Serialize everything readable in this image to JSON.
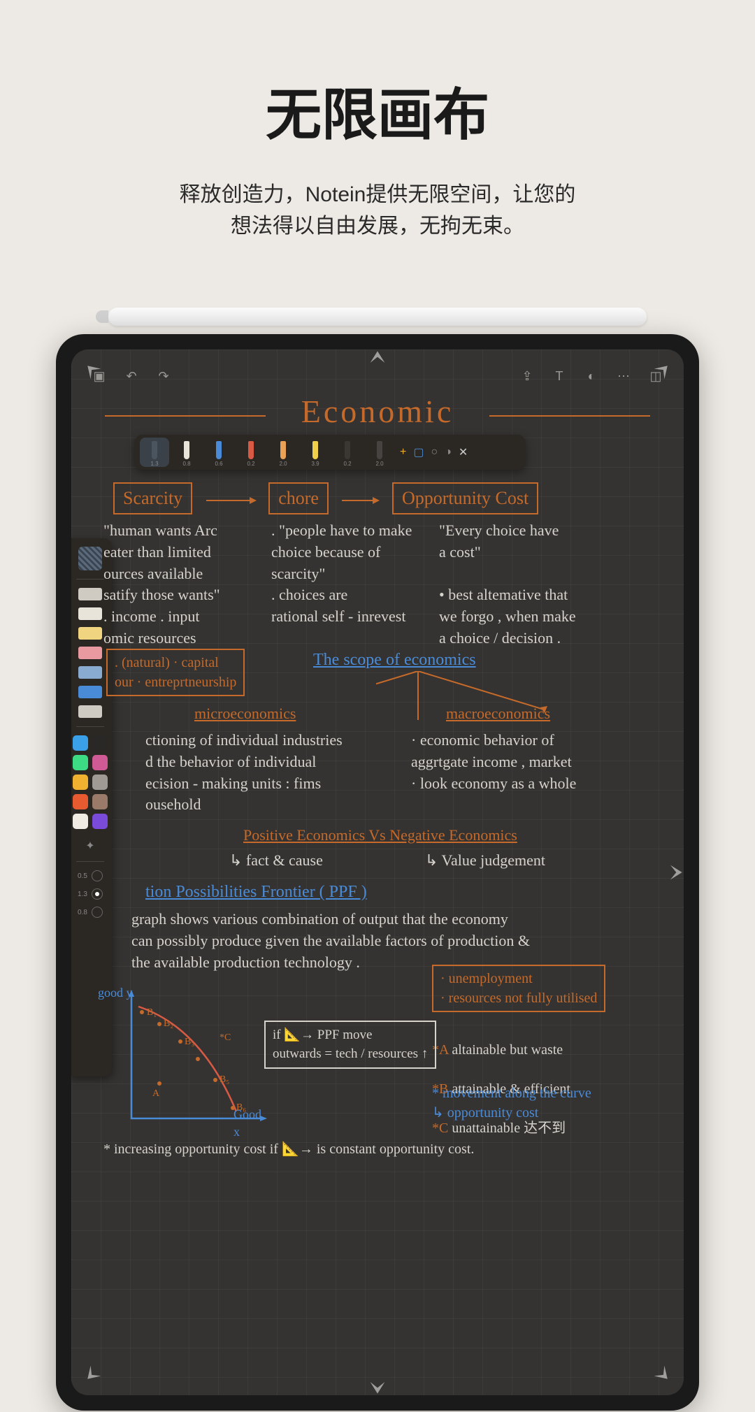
{
  "hero": {
    "title": "无限画布",
    "subtitle_line1": "释放创造力，Notein提供无限空间，让您的",
    "subtitle_line2": "想法得以自由发展，无拘无束。"
  },
  "canvas": {
    "title": "Economic"
  },
  "pens": [
    {
      "color": "#4b5560",
      "size": "1.3"
    },
    {
      "color": "#e8e4da",
      "size": "0.8"
    },
    {
      "color": "#4a8bd8",
      "size": "0.6"
    },
    {
      "color": "#d85a44",
      "size": "0.2"
    },
    {
      "color": "#e8a155",
      "size": "2.0"
    },
    {
      "color": "#f0d04a",
      "size": "3.9"
    },
    {
      "color": "#3a3632",
      "size": "0.2"
    },
    {
      "color": "#464340",
      "size": "2.0"
    }
  ],
  "side_tools": {
    "brushes": [
      "#cfcbc2",
      "#e8e4da",
      "#f0d480",
      "#e89aa0",
      "#8aabd0",
      "#4a8bd8",
      "#cfcbc2"
    ],
    "swatches": [
      "#3aa0e8",
      "#2a2826",
      "#3ddc84",
      "#d05a94",
      "#f0b030",
      "#a09a94",
      "#e85a30",
      "#9a7a68",
      "#f0ece4",
      "#7a4ad8"
    ],
    "sizes": [
      "0.5",
      "1.3",
      "0.8"
    ]
  },
  "concepts": {
    "scarcity": "Scarcity",
    "chore": "chore",
    "opp_cost": "Opportunity  Cost",
    "scarcity_text": "\"human wants Arc\n  eater than limited\n  ources available\n  satify those wants\"\n  . income . input\n  omic resources",
    "chore_text": ". \"people have to make\n   choice because  of\n   scarcity\"\n . choices  are\n   rational self - inrevest",
    "opp_text": "\"Every choice  have\n  a cost\"\n\n• best altemative that\n  we forgo , when  make\n  a choice / decision .",
    "nat_cap": ". (natural) · capital\n  our · entreprtneurship",
    "scope": "The  scope  of economics",
    "micro": "microeconomics",
    "macro": "macroeconomics",
    "micro_text": "ctioning of individual industries\n d the behavior of individual\n ecision - making units : fims\n ousehold",
    "macro_text": "· economic behavior of\n  aggrtgate income , market\n· look economy as a whole",
    "pos_neg": "Positive  Economics  Vs  Negative Economics",
    "pos": "↳ fact & cause",
    "neg": "↳ Value judgement",
    "ppf_head": "tion  Possibilities  Frontier ( PPF )",
    "ppf_text": "graph shows various combination of output that the economy\ncan possibly produce given the available factors of production &\nthe available production technology .",
    "box1": "· unemployment\n· resources not fully utilised",
    "legend": "*A  altainable  but waste\n*B  attainable  & efficient\n*C  unattainable  达不到",
    "movement": "* movement along the curve\n ↳ opportunity cost",
    "ppf_box": "if  📐→ PPF move\noutwards = tech / resources ↑",
    "bottom": "* increasing opportunity cost    if 📐→ is constant opportunity cost.",
    "good_y": "good y",
    "good_x": "Good\n  x"
  }
}
